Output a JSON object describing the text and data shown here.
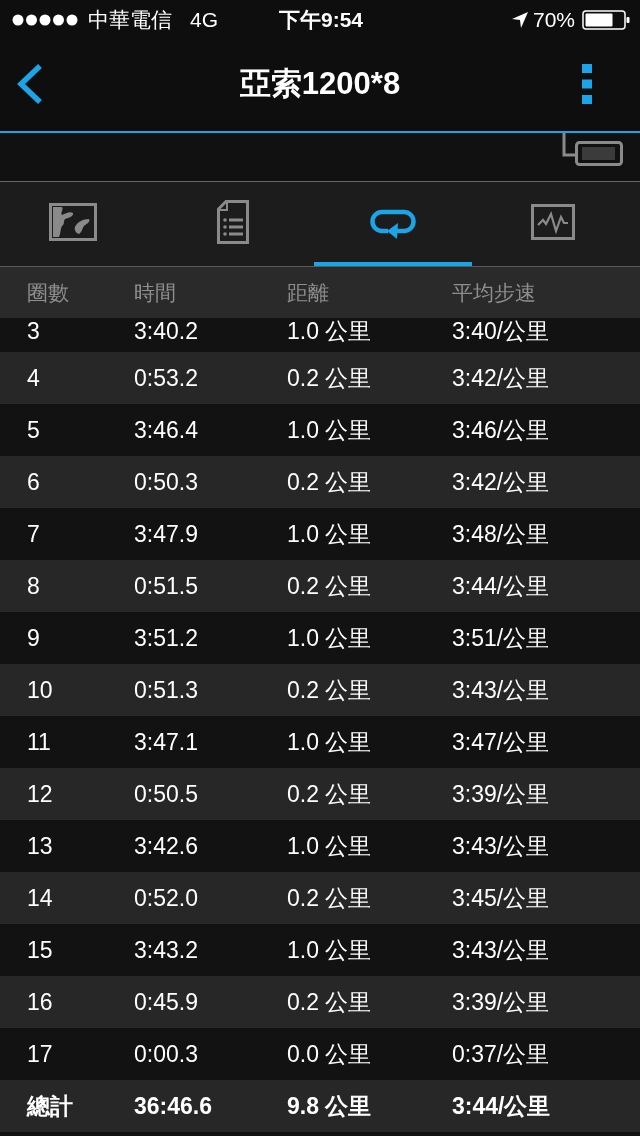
{
  "status_bar": {
    "carrier": "中華電信",
    "network": "4G",
    "time": "下午9:54",
    "battery": "70%"
  },
  "nav_bar": {
    "title": "亞索1200*8"
  },
  "view_tabs": [
    {
      "kind": "map",
      "selected": false
    },
    {
      "kind": "summary",
      "selected": false
    },
    {
      "kind": "laps",
      "selected": true
    },
    {
      "kind": "chart",
      "selected": false
    }
  ],
  "laps_table": {
    "columns": [
      "圈數",
      "時間",
      "距離",
      "平均步速"
    ],
    "rows": [
      [
        "3",
        "3:40.2",
        "1.0 公里",
        "3:40/公里"
      ],
      [
        "4",
        "0:53.2",
        "0.2 公里",
        "3:42/公里"
      ],
      [
        "5",
        "3:46.4",
        "1.0 公里",
        "3:46/公里"
      ],
      [
        "6",
        "0:50.3",
        "0.2 公里",
        "3:42/公里"
      ],
      [
        "7",
        "3:47.9",
        "1.0 公里",
        "3:48/公里"
      ],
      [
        "8",
        "0:51.5",
        "0.2 公里",
        "3:44/公里"
      ],
      [
        "9",
        "3:51.2",
        "1.0 公里",
        "3:51/公里"
      ],
      [
        "10",
        "0:51.3",
        "0.2 公里",
        "3:43/公里"
      ],
      [
        "11",
        "3:47.1",
        "1.0 公里",
        "3:47/公里"
      ],
      [
        "12",
        "0:50.5",
        "0.2 公里",
        "3:39/公里"
      ],
      [
        "13",
        "3:42.6",
        "1.0 公里",
        "3:43/公里"
      ],
      [
        "14",
        "0:52.0",
        "0.2 公里",
        "3:45/公里"
      ],
      [
        "15",
        "3:43.2",
        "1.0 公里",
        "3:43/公里"
      ],
      [
        "16",
        "0:45.9",
        "0.2 公里",
        "3:39/公里"
      ],
      [
        "17",
        "0:00.3",
        "0.0 公里",
        "0:37/公里"
      ]
    ],
    "total": [
      "總計",
      "36:46.6",
      "9.8 公里",
      "3:44/公里"
    ]
  }
}
